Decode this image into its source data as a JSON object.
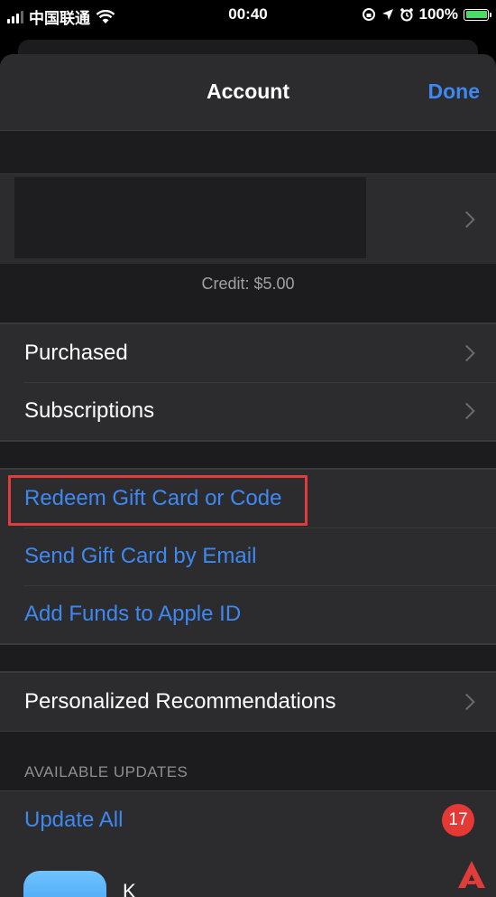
{
  "status_bar": {
    "carrier": "中国联通",
    "time": "00:40",
    "battery": "100%"
  },
  "nav": {
    "title": "Account",
    "done_label": "Done"
  },
  "account": {
    "credit": "Credit: $5.00"
  },
  "menu_primary": [
    {
      "label": "Purchased"
    },
    {
      "label": "Subscriptions"
    }
  ],
  "gift_actions": [
    {
      "label": "Redeem Gift Card or Code"
    },
    {
      "label": "Send Gift Card by Email"
    },
    {
      "label": "Add Funds to Apple ID"
    }
  ],
  "recommendations": {
    "label": "Personalized Recommendations"
  },
  "updates": {
    "header": "AVAILABLE UPDATES",
    "update_all_label": "Update All",
    "badge_count": "17",
    "app_name": "K"
  },
  "colors": {
    "accent": "#3e88f2",
    "highlight": "#e03c3c",
    "badge": "#e53935"
  }
}
